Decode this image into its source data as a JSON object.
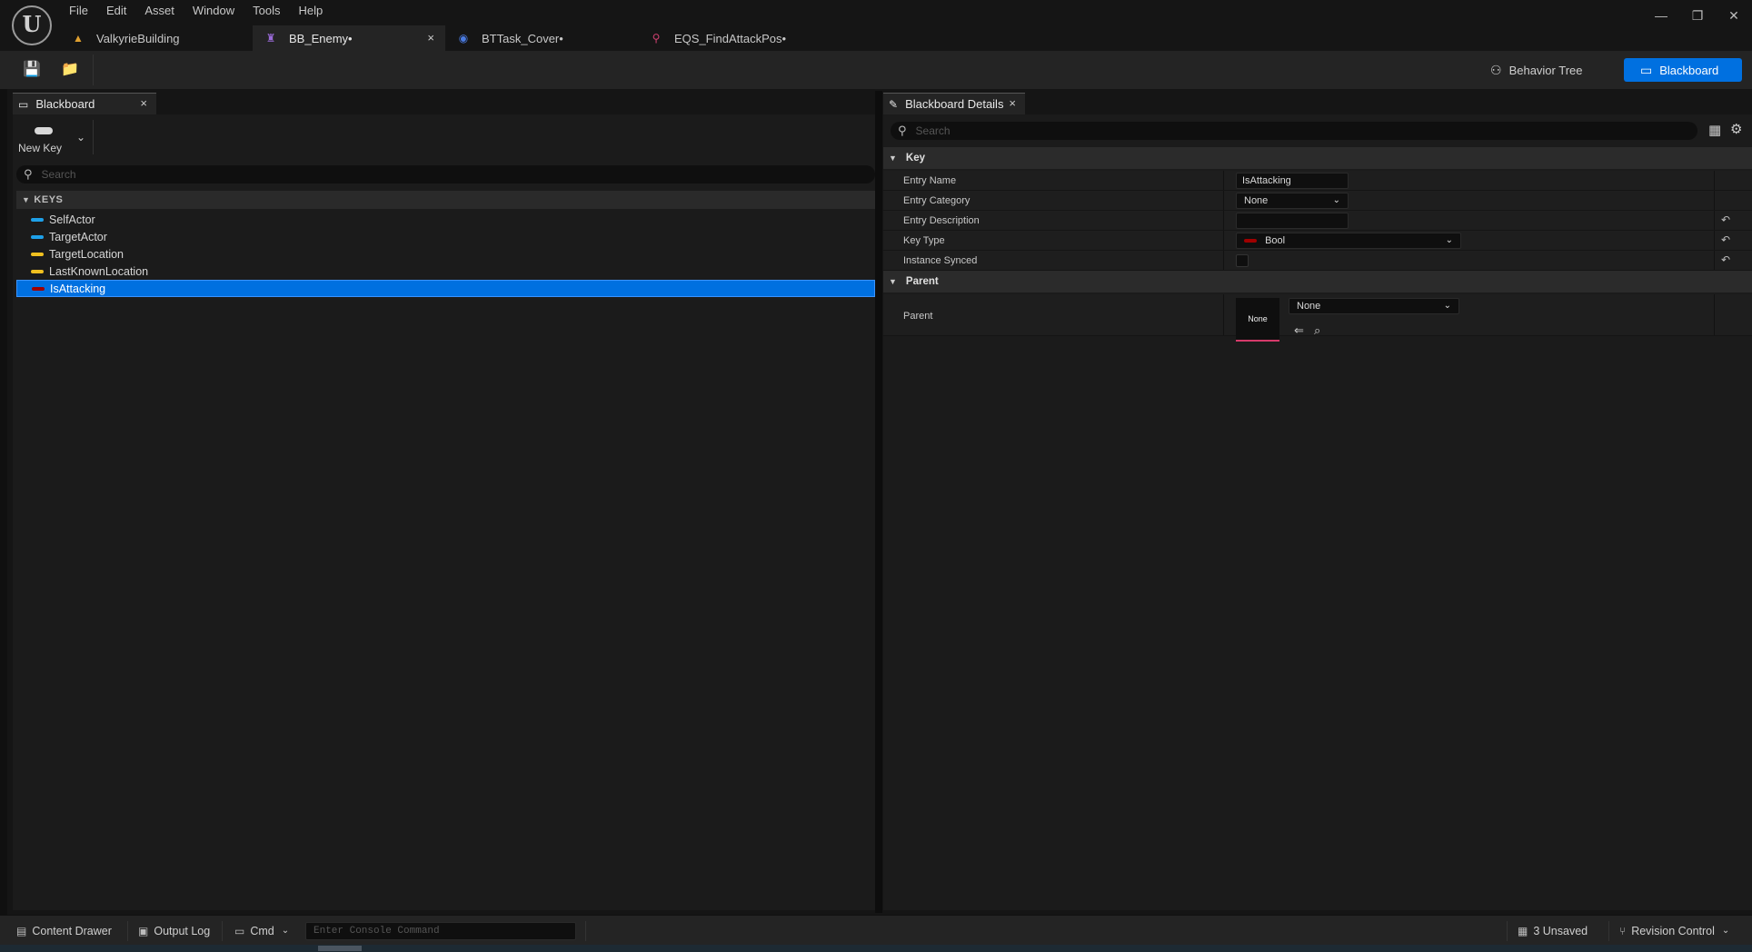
{
  "app": {
    "logo_text": "U"
  },
  "menu": [
    "File",
    "Edit",
    "Asset",
    "Window",
    "Tools",
    "Help"
  ],
  "window_controls": {
    "minimize": "—",
    "restore": "❐",
    "close": "✕"
  },
  "tabs": [
    {
      "label": "ValkyrieBuilding",
      "icon": "level-icon",
      "glyph": "▲",
      "color": "#e0a030",
      "active": false
    },
    {
      "label": "BB_Enemy•",
      "icon": "blackboard-asset-icon",
      "glyph": "♜",
      "color": "#9a6ad8",
      "active": true,
      "close": "×"
    },
    {
      "label": "BTTask_Cover•",
      "icon": "blueprint-icon",
      "glyph": "◉",
      "color": "#4a7ae0",
      "active": false
    },
    {
      "label": "EQS_FindAttackPos•",
      "icon": "eqs-icon",
      "glyph": "⚲",
      "color": "#d04070",
      "active": false
    }
  ],
  "toolbar": {
    "save_icon": "💾",
    "browse_icon": "📁",
    "behavior_tree_label": "Behavior Tree",
    "blackboard_label": "Blackboard"
  },
  "blackboard_panel": {
    "tab_label": "Blackboard",
    "tab_close": "×",
    "new_key_label": "New Key",
    "search_placeholder": "Search",
    "keys_header": "KEYS",
    "keys": [
      {
        "name": "SelfActor",
        "color": "#1ea0e8",
        "selected": false
      },
      {
        "name": "TargetActor",
        "color": "#1ea0e8",
        "selected": false
      },
      {
        "name": "TargetLocation",
        "color": "#f0c020",
        "selected": false
      },
      {
        "name": "LastKnownLocation",
        "color": "#f0c020",
        "selected": false
      },
      {
        "name": "IsAttacking",
        "color": "#a00000",
        "selected": true
      }
    ]
  },
  "details_panel": {
    "tab_label": "Blackboard Details",
    "tab_close": "×",
    "search_placeholder": "Search",
    "key_section": "Key",
    "entry_name_label": "Entry Name",
    "entry_name_value": "IsAttacking",
    "entry_category_label": "Entry Category",
    "entry_category_value": "None",
    "entry_description_label": "Entry Description",
    "entry_description_value": "",
    "key_type_label": "Key Type",
    "key_type_value": "Bool",
    "key_type_color": "#a00000",
    "instance_synced_label": "Instance Synced",
    "parent_section": "Parent",
    "parent_label": "Parent",
    "parent_thumb_text": "None",
    "parent_value": "None"
  },
  "statusbar": {
    "content_drawer": "Content Drawer",
    "output_log": "Output Log",
    "cmd": "Cmd",
    "console_placeholder": "Enter Console Command",
    "unsaved": "3 Unsaved",
    "revision_control": "Revision Control"
  }
}
